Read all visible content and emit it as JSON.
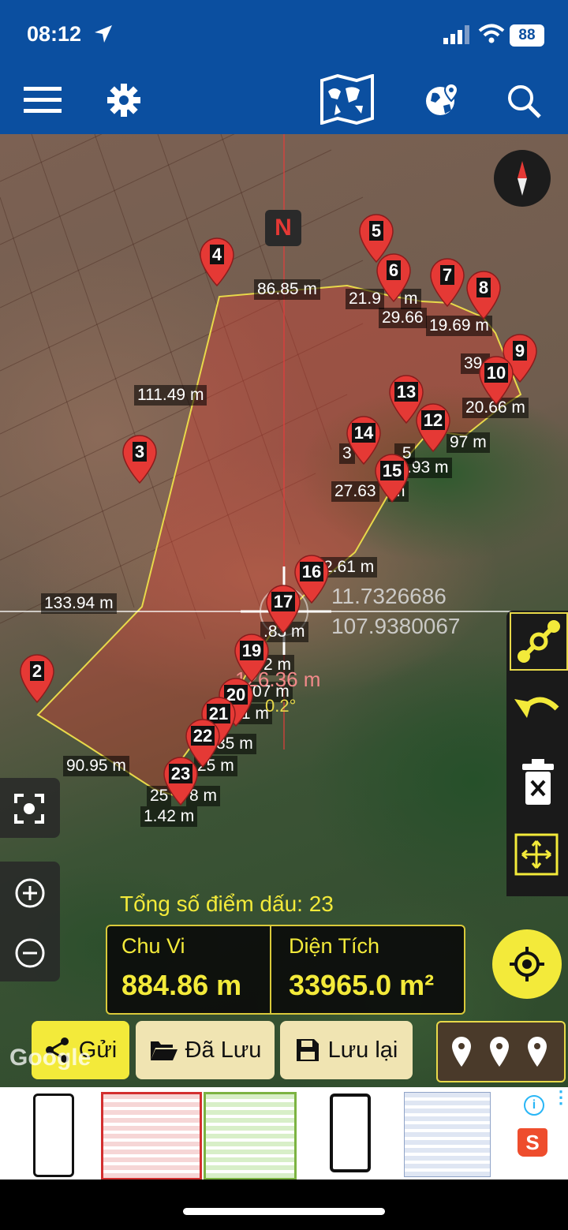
{
  "status_bar": {
    "time": "08:12",
    "battery": "88"
  },
  "toolbar": {
    "menu_icon": "hamburger-icon",
    "settings_icon": "gear-icon",
    "map_type_icon": "world-map-icon",
    "layers_icon": "globe-pin-icon",
    "search_icon": "search-icon"
  },
  "map": {
    "north_badge": "N",
    "markers": [
      "2",
      "3",
      "4",
      "5",
      "6",
      "7",
      "8",
      "9",
      "10",
      "12",
      "13",
      "14",
      "15",
      "16",
      "17",
      "19",
      "20",
      "21",
      "22",
      "23"
    ],
    "segment_labels": {
      "l1": "86.85 m",
      "l2": "21.9",
      "l2b": "m",
      "l3": "29.66",
      "l4": "19.69 m",
      "l5": "39.",
      "l6": "111.49 m",
      "l7": "20.66 m",
      "l8": "97 m",
      "l9": ".93 m",
      "l10": "3",
      "l11": ".5",
      "l12": "27.63",
      "l12b": "m",
      "l13": "2.61 m",
      "l14": "133.94 m",
      "l15": ".83 m",
      "l16": "2 m",
      "l17": "07 m",
      "l18": ".1 m",
      "l19": "35 m",
      "l20": "25 m",
      "l21": "90.95 m",
      "l22": "25",
      "l23": "8 m",
      "l24": "1.42 m"
    },
    "cursor": {
      "lat": "11.7326686",
      "lon": "107.9380067",
      "distance": "126.36 m",
      "angle": "0.2°"
    },
    "google_logo": "Google"
  },
  "summary": {
    "points_label": "Tổng số điểm dấu:",
    "points_value": "23",
    "perimeter_label": "Chu Vi",
    "perimeter_value": "884.86 m",
    "area_label": "Diện Tích",
    "area_value": "33965.0 m²"
  },
  "actions": {
    "send": "Gửi",
    "saved": "Đã Lưu",
    "save": "Lưu lại"
  },
  "colors": {
    "toolbar": "#0b4fa0",
    "accent_yellow": "#f3ea3a",
    "pin_red": "#e53935",
    "polygon_fill": "rgba(230,60,50,0.35)"
  }
}
